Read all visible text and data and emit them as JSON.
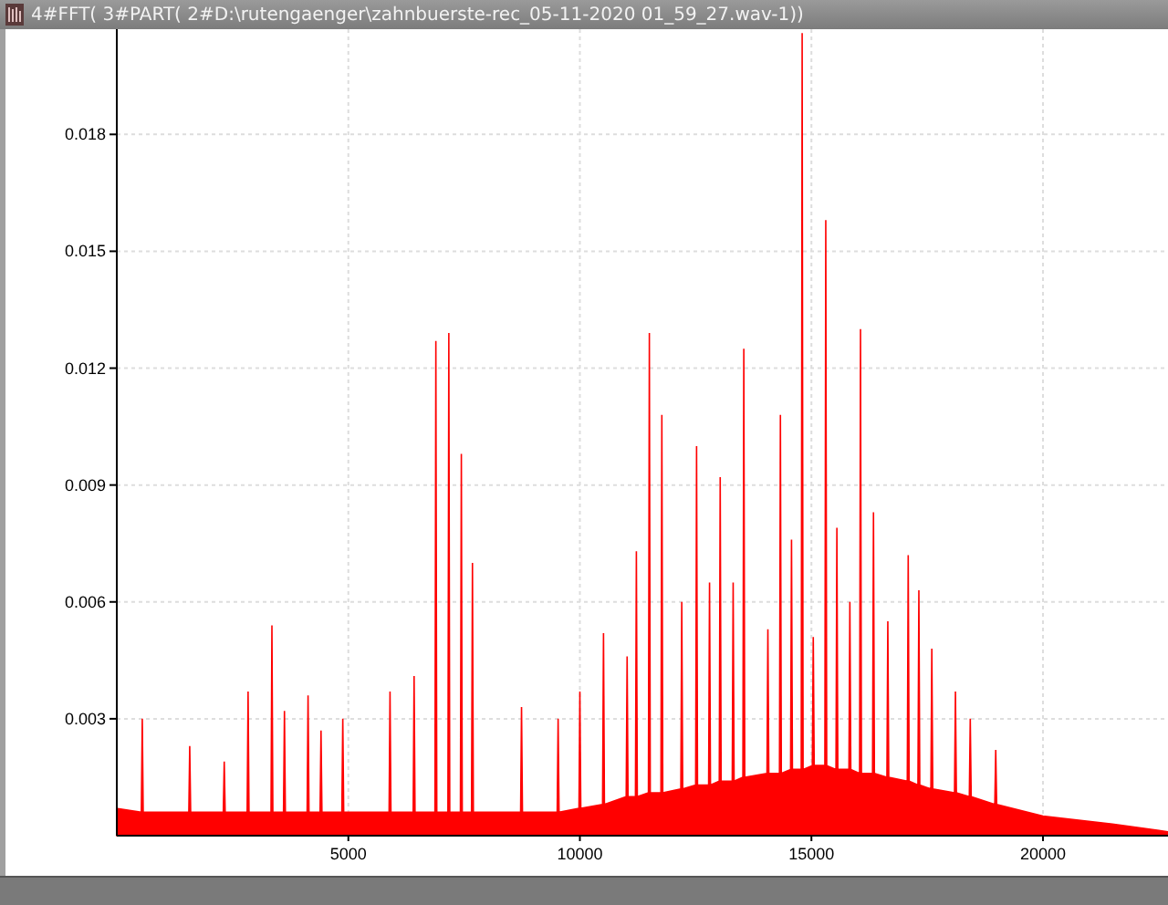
{
  "window": {
    "title": "4#FFT( 3#PART( 2#D:\\rutengaenger\\zahnbuerste-rec_05-11-2020 01_59_27.wav-1))"
  },
  "plot": {
    "chart_data": {
      "type": "area",
      "xlim": [
        0,
        22700
      ],
      "ylim": [
        0,
        0.0207
      ],
      "xticks": [
        5000,
        10000,
        15000,
        20000
      ],
      "yticks": [
        0.003,
        0.006,
        0.009,
        0.012,
        0.015,
        0.018
      ],
      "x": [
        0,
        530,
        550,
        570,
        1555,
        1575,
        1595,
        2300,
        2320,
        2340,
        2815,
        2835,
        2855,
        3330,
        3350,
        3370,
        3600,
        3620,
        3640,
        4110,
        4130,
        4150,
        4390,
        4410,
        4430,
        4860,
        4880,
        4900,
        5880,
        5900,
        5920,
        6400,
        6420,
        6440,
        6870,
        6890,
        6910,
        7150,
        7170,
        7190,
        7420,
        7440,
        7460,
        7660,
        7680,
        7700,
        8720,
        8740,
        8760,
        9510,
        9530,
        9550,
        9980,
        10000,
        10020,
        10490,
        10510,
        10530,
        11000,
        11020,
        11040,
        11200,
        11220,
        11240,
        11480,
        11500,
        11520,
        11750,
        11770,
        11790,
        12180,
        12200,
        12220,
        12500,
        12520,
        12540,
        12780,
        12800,
        12820,
        13010,
        13030,
        13050,
        13290,
        13310,
        13330,
        13520,
        13540,
        13560,
        14040,
        14060,
        14080,
        14310,
        14330,
        14350,
        14550,
        14570,
        14590,
        14780,
        14800,
        14820,
        15020,
        15040,
        15060,
        15290,
        15310,
        15330,
        15530,
        15550,
        15570,
        15810,
        15830,
        15850,
        16040,
        16060,
        16080,
        16320,
        16340,
        16360,
        16630,
        16650,
        16670,
        17070,
        17090,
        17110,
        17300,
        17320,
        17340,
        17580,
        17600,
        17620,
        18090,
        18110,
        18130,
        18410,
        18430,
        18450,
        18960,
        18980,
        19000,
        20000,
        21500,
        22700
      ],
      "grid": true,
      "series": [
        {
          "color": "#ff0000",
          "values": [
            0.0007,
            0.0006,
            0.003,
            0.0006,
            0.0006,
            0.0023,
            0.0006,
            0.0006,
            0.0019,
            0.0006,
            0.0006,
            0.0037,
            0.0006,
            0.0006,
            0.0054,
            0.0006,
            0.0006,
            0.0032,
            0.0006,
            0.0006,
            0.0036,
            0.0006,
            0.0006,
            0.0027,
            0.0006,
            0.0006,
            0.003,
            0.0006,
            0.0006,
            0.0037,
            0.0006,
            0.0006,
            0.0041,
            0.0006,
            0.0006,
            0.0127,
            0.0006,
            0.0006,
            0.0129,
            0.0006,
            0.0006,
            0.0098,
            0.0006,
            0.0006,
            0.007,
            0.0006,
            0.0006,
            0.0033,
            0.0006,
            0.0006,
            0.003,
            0.0006,
            0.0007,
            0.0037,
            0.0007,
            0.0008,
            0.0052,
            0.0008,
            0.001,
            0.0046,
            0.001,
            0.001,
            0.0073,
            0.001,
            0.0011,
            0.0129,
            0.0011,
            0.0011,
            0.0108,
            0.0011,
            0.0012,
            0.006,
            0.0012,
            0.0013,
            0.01,
            0.0013,
            0.0013,
            0.0065,
            0.0013,
            0.0014,
            0.0092,
            0.0014,
            0.0014,
            0.0065,
            0.0014,
            0.0015,
            0.0125,
            0.0015,
            0.0016,
            0.0053,
            0.0016,
            0.0016,
            0.0108,
            0.0016,
            0.0017,
            0.0076,
            0.0017,
            0.0017,
            0.0206,
            0.0017,
            0.0018,
            0.0051,
            0.0018,
            0.0018,
            0.0158,
            0.0018,
            0.0017,
            0.0079,
            0.0017,
            0.0017,
            0.006,
            0.0017,
            0.0016,
            0.013,
            0.0016,
            0.0016,
            0.0083,
            0.0016,
            0.0015,
            0.0055,
            0.0015,
            0.0014,
            0.0072,
            0.0014,
            0.0013,
            0.0063,
            0.0013,
            0.0012,
            0.0048,
            0.0012,
            0.0011,
            0.0037,
            0.0011,
            0.001,
            0.003,
            0.001,
            0.0008,
            0.0022,
            0.0008,
            0.0005,
            0.0003,
            0.0001
          ]
        }
      ]
    }
  }
}
